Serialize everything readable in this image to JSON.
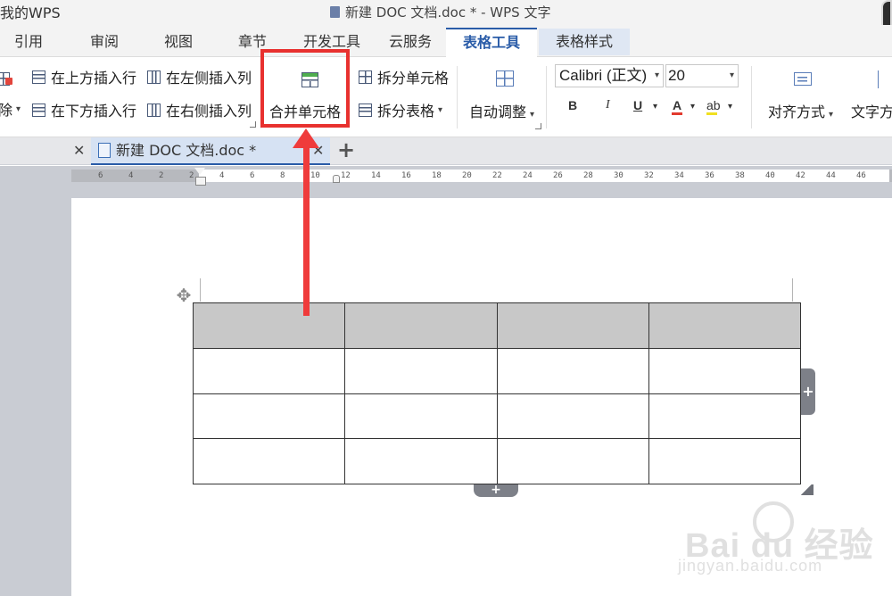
{
  "window": {
    "title": "新建 DOC 文档.doc * - WPS 文字"
  },
  "menu_tabs": [
    {
      "label": "引用"
    },
    {
      "label": "审阅"
    },
    {
      "label": "视图"
    },
    {
      "label": "章节"
    },
    {
      "label": "开发工具"
    },
    {
      "label": "云服务"
    },
    {
      "label": "表格工具",
      "active": true
    },
    {
      "label": "表格样式"
    }
  ],
  "ribbon": {
    "delete_label": "除",
    "insert_row_above": "在上方插入行",
    "insert_row_below": "在下方插入行",
    "insert_col_left": "在左侧插入列",
    "insert_col_right": "在右侧插入列",
    "merge_cells": "合并单元格",
    "split_cells": "拆分单元格",
    "split_table": "拆分表格",
    "auto_fit": "自动调整",
    "font_name": "Calibri (正文)",
    "font_size": "20",
    "bold": "B",
    "italic": "I",
    "underline": "U",
    "font_color": "A",
    "highlight": "ab",
    "alignment": "对齐方式",
    "text_direction": "文字方"
  },
  "doc_tabs": [
    {
      "label": "我的WPS"
    },
    {
      "label": "新建 DOC 文档.doc *",
      "active": true
    }
  ],
  "ruler_ticks": [
    "6",
    "4",
    "2",
    "2",
    "4",
    "6",
    "8",
    "10",
    "12",
    "14",
    "16",
    "18",
    "20",
    "22",
    "24",
    "26",
    "28",
    "30",
    "32",
    "34",
    "36",
    "38",
    "40",
    "42",
    "44",
    "46"
  ],
  "table": {
    "rows": 4,
    "cols": 4,
    "header_fill": "#c8c8c8"
  },
  "annotation": {
    "color": "#e8312f",
    "target": "merge-cells-button"
  },
  "watermark": {
    "main": "Bai du 经验",
    "sub": "jingyan.baidu.com"
  }
}
